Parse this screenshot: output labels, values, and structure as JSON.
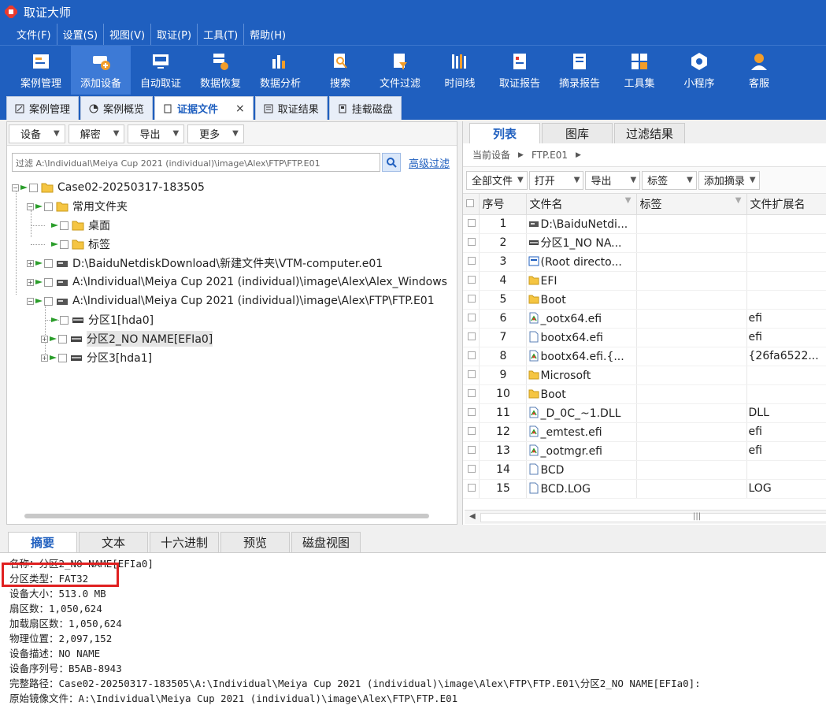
{
  "app": {
    "title": "取证大师"
  },
  "menu": [
    {
      "label": "文件(F)"
    },
    {
      "label": "设置(S)"
    },
    {
      "label": "视图(V)"
    },
    {
      "label": "取证(P)"
    },
    {
      "label": "工具(T)"
    },
    {
      "label": "帮助(H)"
    }
  ],
  "toolbar": [
    {
      "label": "案例管理",
      "icon": "case-manage-icon"
    },
    {
      "label": "添加设备",
      "icon": "add-device-icon",
      "active": true
    },
    {
      "label": "自动取证",
      "icon": "auto-forensics-icon"
    },
    {
      "label": "数据恢复",
      "icon": "data-recovery-icon"
    },
    {
      "label": "数据分析",
      "icon": "data-analysis-icon"
    },
    {
      "label": "搜索",
      "icon": "search-icon"
    },
    {
      "label": "文件过滤",
      "icon": "file-filter-icon"
    },
    {
      "label": "时间线",
      "icon": "timeline-icon"
    },
    {
      "label": "取证报告",
      "icon": "report-icon"
    },
    {
      "label": "摘录报告",
      "icon": "excerpt-report-icon"
    },
    {
      "label": "工具集",
      "icon": "toolset-icon"
    },
    {
      "label": "小程序",
      "icon": "mini-program-icon"
    },
    {
      "label": "客服",
      "icon": "customer-service-icon"
    }
  ],
  "doc_tabs": [
    {
      "label": "案例管理"
    },
    {
      "label": "案例概览"
    },
    {
      "label": "证据文件",
      "active": true,
      "close": "×"
    },
    {
      "label": "取证结果"
    },
    {
      "label": "挂载磁盘"
    }
  ],
  "left_panel": {
    "buttons": [
      {
        "label": "设备"
      },
      {
        "label": "解密"
      },
      {
        "label": "导出"
      },
      {
        "label": "更多"
      }
    ],
    "filter_text": "过滤 A:\\Individual\\Meiya Cup 2021 (individual)\\image\\Alex\\FTP\\FTP.E01",
    "advanced_filter": "高级过滤",
    "tree": [
      {
        "label": "Case02-20250317-183505"
      },
      {
        "label": "常用文件夹"
      },
      {
        "label": "桌面"
      },
      {
        "label": "标签"
      },
      {
        "label": "D:\\BaiduNetdiskDownload\\新建文件夹\\VTM-computer.e01"
      },
      {
        "label": "A:\\Individual\\Meiya Cup 2021 (individual)\\image\\Alex\\Alex_Windows"
      },
      {
        "label": "A:\\Individual\\Meiya Cup 2021 (individual)\\image\\Alex\\FTP\\FTP.E01"
      },
      {
        "label": "分区1[hda0]"
      },
      {
        "label": "分区2_NO NAME[EFIa0]"
      },
      {
        "label": "分区3[hda1]"
      }
    ]
  },
  "right_panel": {
    "tabs": [
      {
        "label": "列表",
        "active": true
      },
      {
        "label": "图库"
      },
      {
        "label": "过滤结果"
      }
    ],
    "breadcrumb": {
      "root": "当前设备",
      "current": "FTP.E01"
    },
    "buttons": [
      {
        "label": "全部文件"
      },
      {
        "label": "打开"
      },
      {
        "label": "导出"
      },
      {
        "label": "标签"
      },
      {
        "label": "添加摘录"
      }
    ],
    "columns": {
      "index": "序号",
      "name": "文件名",
      "tag": "标签",
      "ext": "文件扩展名"
    },
    "rows": [
      {
        "index": "1",
        "name": "D:\\BaiduNetdi...",
        "tag": "",
        "ext": "",
        "icon": "drive-icon"
      },
      {
        "index": "2",
        "name": "分区1_NO NA...",
        "tag": "",
        "ext": "",
        "icon": "partition-icon"
      },
      {
        "index": "3",
        "name": "(Root directo...",
        "tag": "",
        "ext": "",
        "icon": "root-directory-icon"
      },
      {
        "index": "4",
        "name": "EFI",
        "tag": "",
        "ext": "",
        "icon": "folder-icon"
      },
      {
        "index": "5",
        "name": "Boot",
        "tag": "",
        "ext": "",
        "icon": "folder-icon"
      },
      {
        "index": "6",
        "name": "_ootx64.efi",
        "tag": "",
        "ext": "efi",
        "icon": "deleted-file-icon"
      },
      {
        "index": "7",
        "name": "bootx64.efi",
        "tag": "",
        "ext": "efi",
        "icon": "file-icon"
      },
      {
        "index": "8",
        "name": "bootx64.efi.{...",
        "tag": "",
        "ext": "{26fa6522...",
        "icon": "deleted-file-icon"
      },
      {
        "index": "9",
        "name": "Microsoft",
        "tag": "",
        "ext": "",
        "icon": "folder-icon"
      },
      {
        "index": "10",
        "name": "Boot",
        "tag": "",
        "ext": "",
        "icon": "folder-icon"
      },
      {
        "index": "11",
        "name": "_D_0C_~1.DLL",
        "tag": "",
        "ext": "DLL",
        "icon": "deleted-file-icon"
      },
      {
        "index": "12",
        "name": "_emtest.efi",
        "tag": "",
        "ext": "efi",
        "icon": "deleted-file-icon"
      },
      {
        "index": "13",
        "name": "_ootmgr.efi",
        "tag": "",
        "ext": "efi",
        "icon": "deleted-file-icon"
      },
      {
        "index": "14",
        "name": "BCD",
        "tag": "",
        "ext": "",
        "icon": "file-icon"
      },
      {
        "index": "15",
        "name": "BCD.LOG",
        "tag": "",
        "ext": "LOG",
        "icon": "file-icon"
      }
    ]
  },
  "bottom_panel": {
    "tabs": [
      {
        "label": "摘要",
        "active": true
      },
      {
        "label": "文本"
      },
      {
        "label": "十六进制"
      },
      {
        "label": "预览"
      },
      {
        "label": "磁盘视图"
      }
    ],
    "summary": [
      "名称：分区2_NO NAME[EFIa0]",
      "分区类型：FAT32",
      "设备大小：513.0 MB",
      "扇区数：1,050,624",
      "加载扇区数：1,050,624",
      "物理位置：2,097,152",
      "设备描述：NO NAME",
      "设备序列号：B5AB-8943",
      "完整路径：Case02-20250317-183505\\A:\\Individual\\Meiya Cup 2021 (individual)\\image\\Alex\\FTP\\FTP.E01\\分区2_NO NAME[EFIa0]:",
      "原始镜像文件：A:\\Individual\\Meiya Cup 2021 (individual)\\image\\Alex\\FTP\\FTP.E01"
    ]
  },
  "colors": {
    "brand": "#1f5fbf",
    "highlight": "#e02020"
  }
}
